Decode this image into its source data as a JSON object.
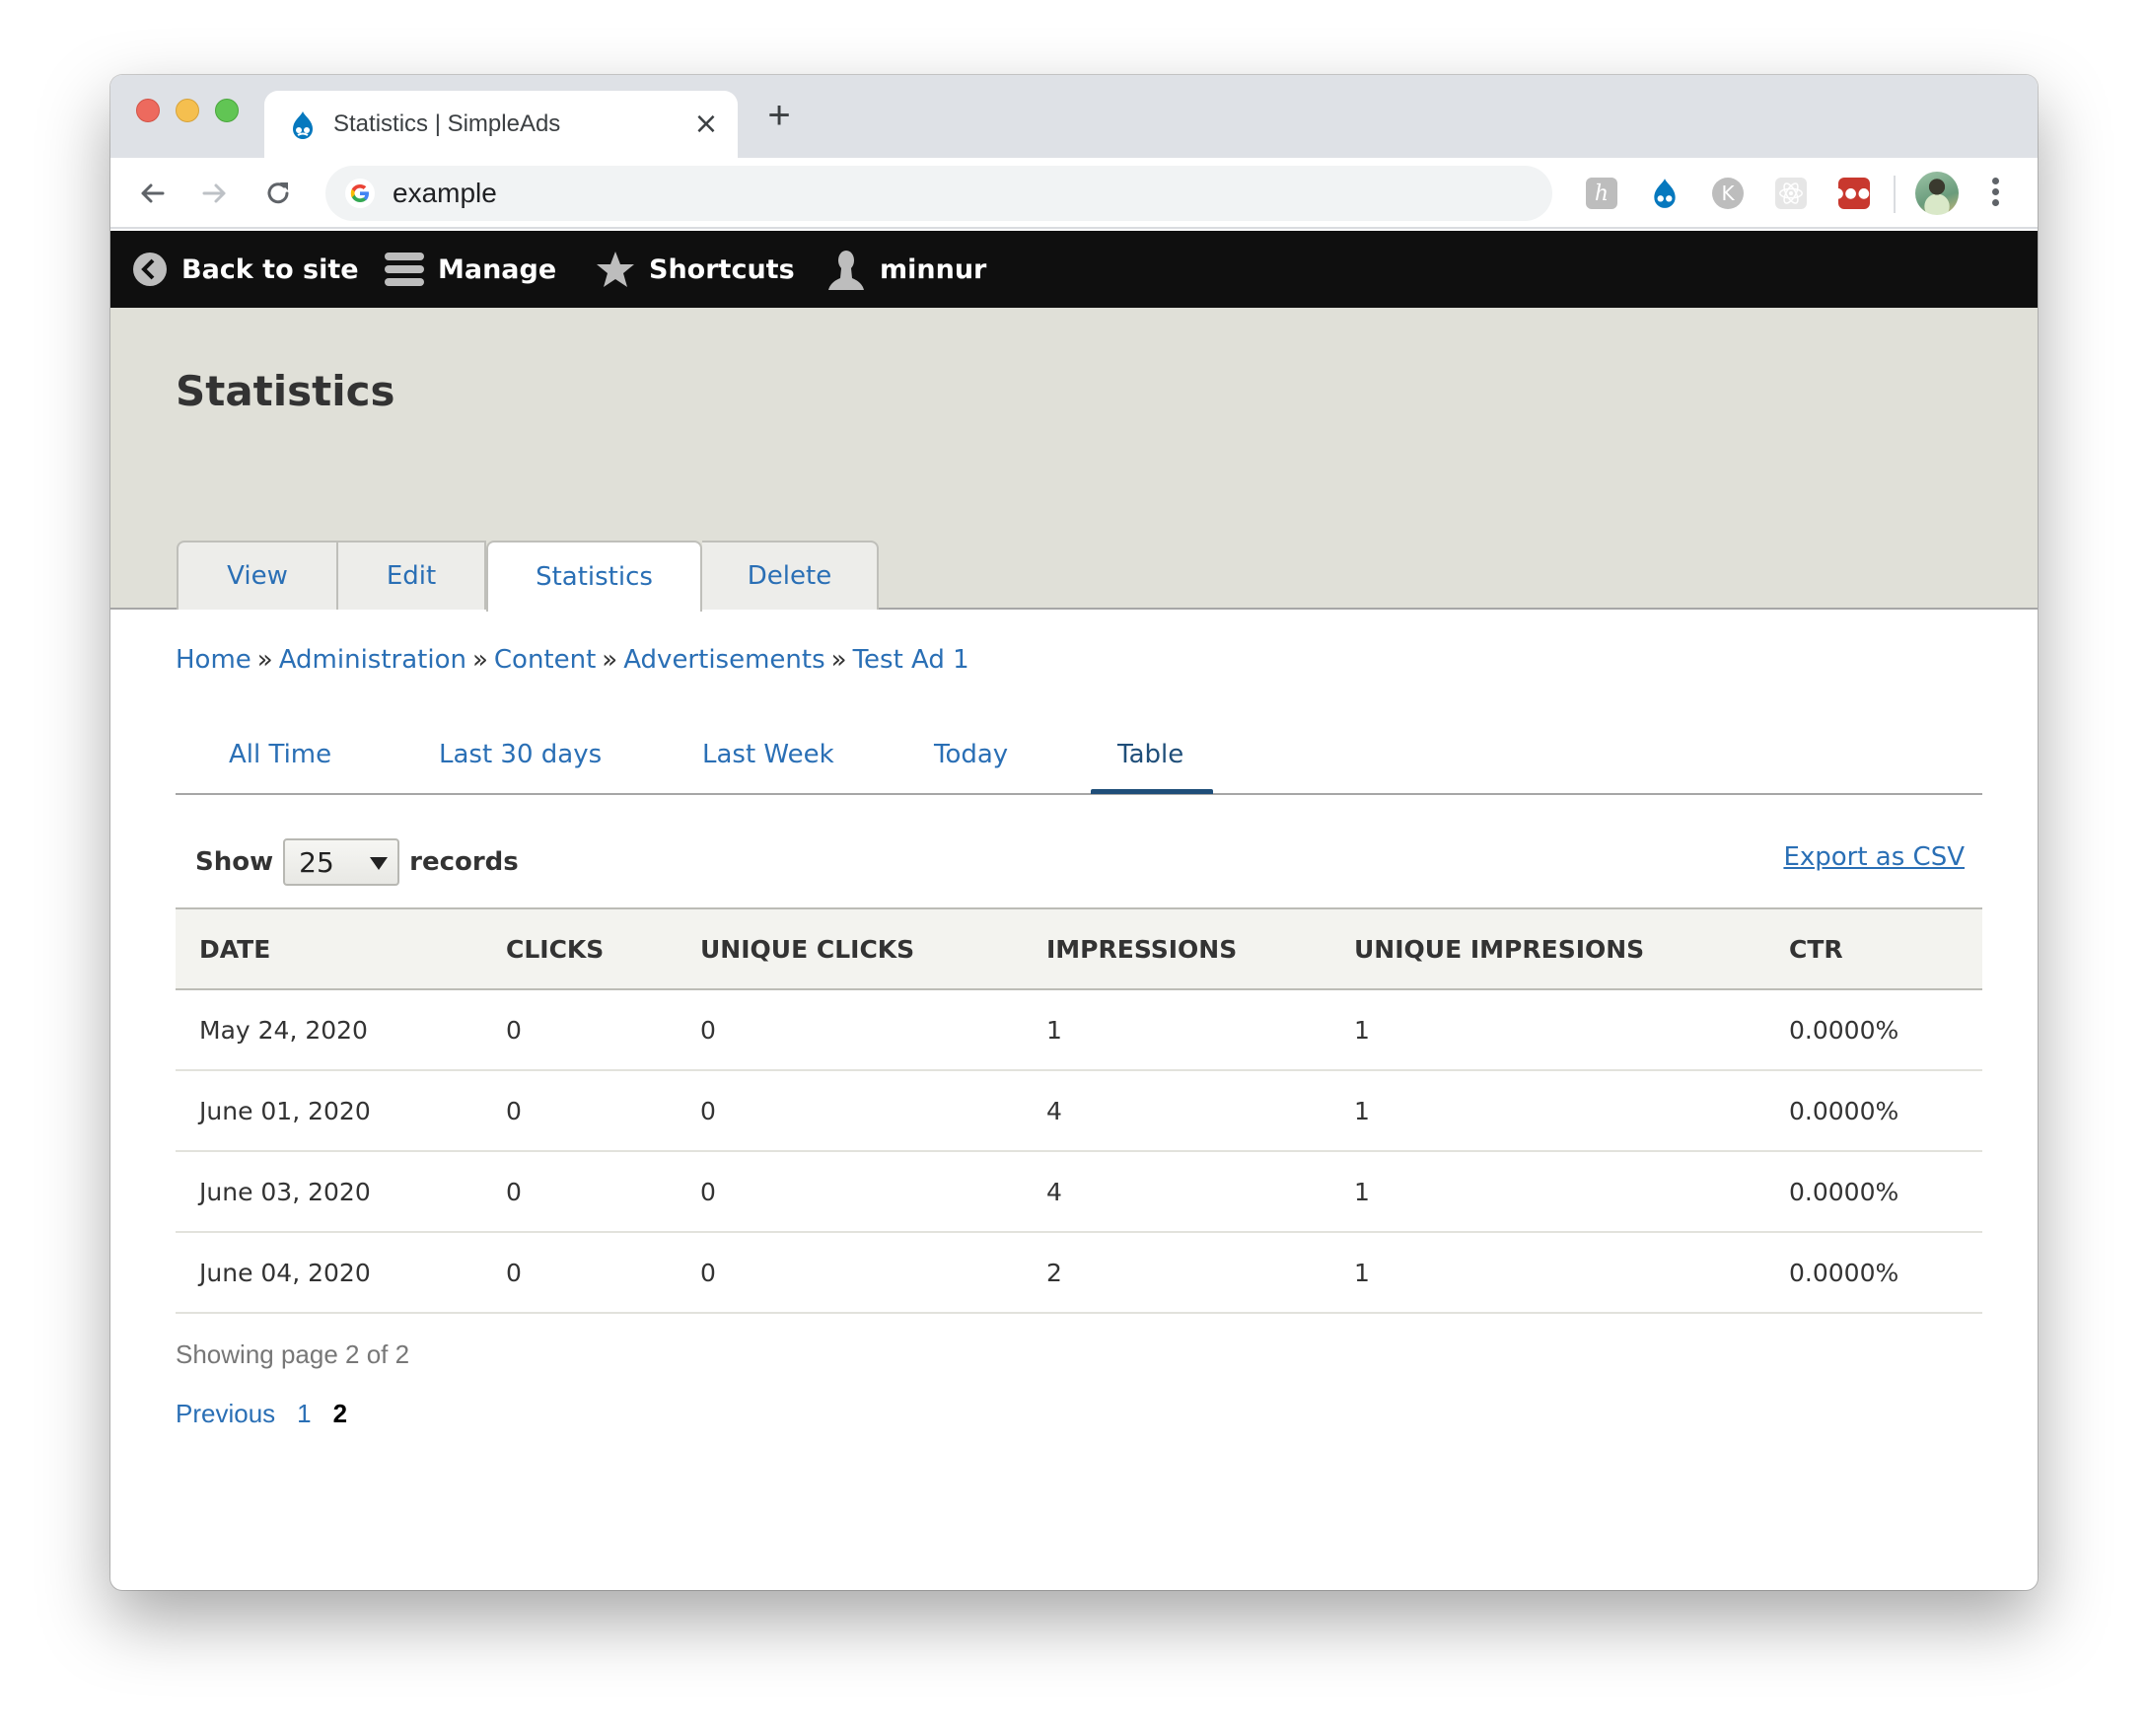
{
  "browser": {
    "tab_title": "Statistics | SimpleAds",
    "tab_close_icon": "close-icon",
    "new_tab_icon": "plus-icon",
    "address": "example",
    "extensions": [
      "honey-extension-icon",
      "drupal-extension-icon",
      "k-extension-icon",
      "react-devtools-icon",
      "lastpass-icon"
    ],
    "colors": {
      "lastpass": "#c8382e",
      "drupal_blue": "#0678be"
    }
  },
  "toolbar": {
    "back_to_site": "Back to site",
    "manage": "Manage",
    "shortcuts": "Shortcuts",
    "user": "minnur"
  },
  "page": {
    "title": "Statistics",
    "primary_tabs": [
      {
        "label": "View",
        "active": false
      },
      {
        "label": "Edit",
        "active": false
      },
      {
        "label": "Statistics",
        "active": true
      },
      {
        "label": "Delete",
        "active": false
      }
    ],
    "breadcrumb": [
      "Home",
      "Administration",
      "Content",
      "Advertisements",
      "Test Ad 1"
    ],
    "breadcrumb_separator": "»",
    "secondary_tabs": [
      {
        "label": "All Time",
        "active": false
      },
      {
        "label": "Last 30 days",
        "active": false
      },
      {
        "label": "Last Week",
        "active": false
      },
      {
        "label": "Today",
        "active": false
      },
      {
        "label": "Table",
        "active": true
      }
    ]
  },
  "records": {
    "show_label": "Show",
    "per_page": "25",
    "records_label": "records",
    "export_label": "Export as CSV"
  },
  "table": {
    "headers": [
      "DATE",
      "CLICKS",
      "UNIQUE CLICKS",
      "IMPRESSIONS",
      "UNIQUE IMPRESIONS",
      "CTR"
    ],
    "rows": [
      [
        "May 24, 2020",
        "0",
        "0",
        "1",
        "1",
        "0.0000%"
      ],
      [
        "June 01, 2020",
        "0",
        "0",
        "4",
        "1",
        "0.0000%"
      ],
      [
        "June 03, 2020",
        "0",
        "0",
        "4",
        "1",
        "0.0000%"
      ],
      [
        "June 04, 2020",
        "0",
        "0",
        "2",
        "1",
        "0.0000%"
      ]
    ]
  },
  "pager": {
    "info": "Showing page 2 of 2",
    "previous": "Previous",
    "pages": [
      "1",
      "2"
    ],
    "current": "2"
  },
  "theme": {
    "link_color": "#2a6fb5",
    "active_tab_color": "#1f4e79",
    "toolbar_bg": "#0f0f0f",
    "header_bg": "#e0e0d8"
  }
}
